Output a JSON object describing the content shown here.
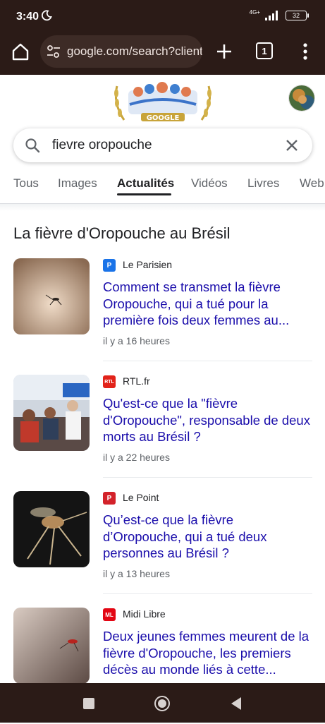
{
  "status_bar": {
    "time": "3:40",
    "network": "4G+",
    "battery": "32"
  },
  "browser": {
    "url": "google.com/search?client",
    "tab_count": "1"
  },
  "search": {
    "query": "fievre oropouche"
  },
  "filters": [
    {
      "label": "Tous"
    },
    {
      "label": "Images"
    },
    {
      "label": "Actualités"
    },
    {
      "label": "Vidéos"
    },
    {
      "label": "Livres"
    },
    {
      "label": "Web"
    }
  ],
  "active_filter": "Actualités",
  "doodle_text": "GOOGLE",
  "section_title": "La fièvre d'Oropouche au Brésil",
  "articles": [
    {
      "source": "Le Parisien",
      "logo": "P",
      "logo_color": "#1a73e8",
      "headline": "Comment se transmet la fièvre Oropouche, qui a tué pour la première fois deux femmes au...",
      "age": "il y a 16 heures"
    },
    {
      "source": "RTL.fr",
      "logo": "RTL",
      "logo_color": "#e2231a",
      "headline": "Qu'est-ce que la \"fièvre d'Oropouche\", responsable de deux morts au Brésil ?",
      "age": "il y a 22 heures"
    },
    {
      "source": "Le Point",
      "logo": "P",
      "logo_color": "#d3222a",
      "headline": "Qu’est-ce que la fièvre d’Oropouche, qui a tué deux personnes au Brésil ?",
      "age": "il y a 13 heures"
    },
    {
      "source": "Midi Libre",
      "logo": "ML",
      "logo_color": "#e30613",
      "headline": "Deux jeunes femmes meurent de la fièvre d'Oropouche, les premiers décès au monde liés à cette...",
      "age": ""
    }
  ],
  "colors": {
    "chrome_bg": "#2b1b17",
    "link": "#1a0dab",
    "text": "#202124",
    "muted": "#5f6368"
  }
}
